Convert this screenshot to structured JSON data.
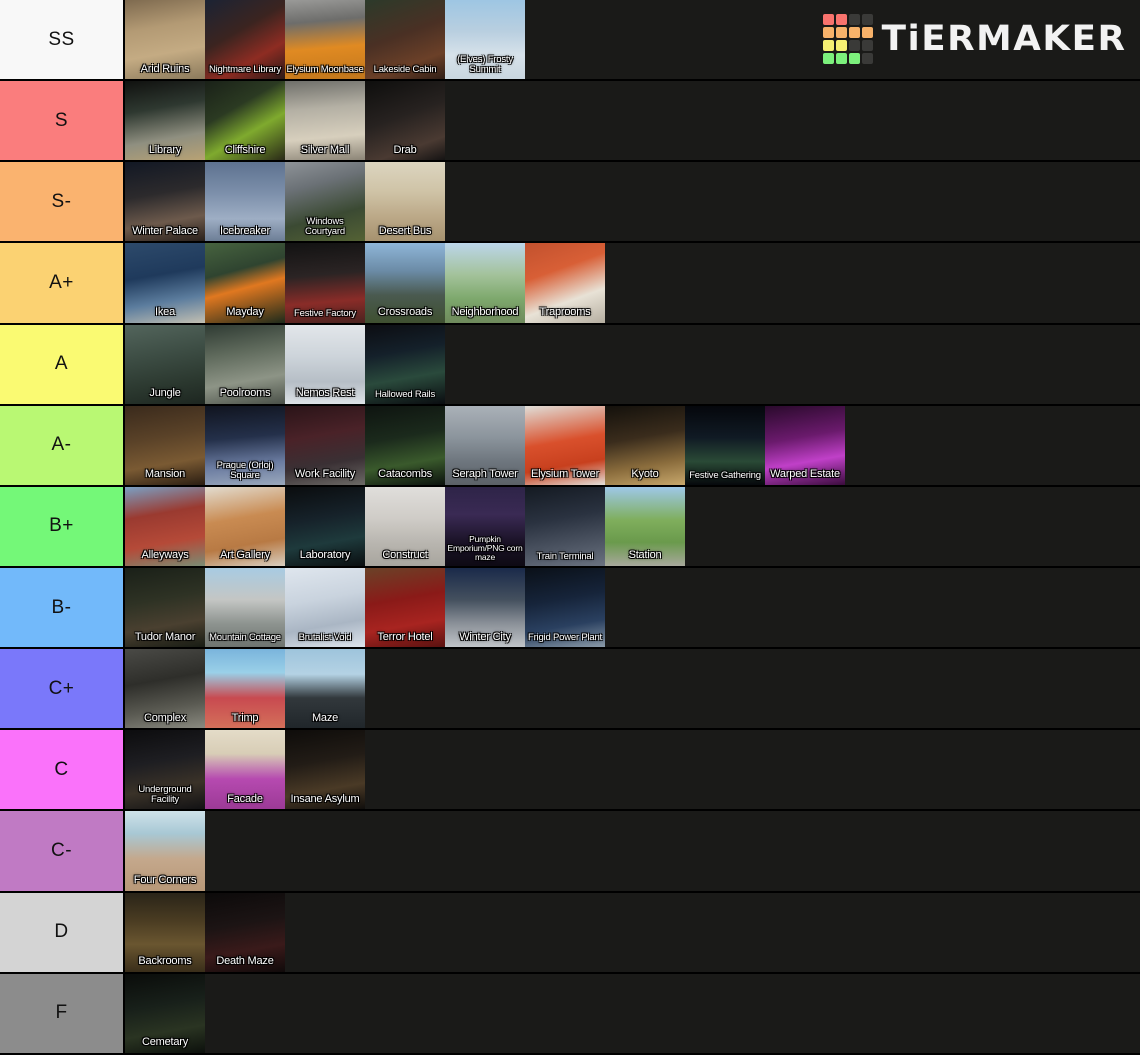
{
  "brand": {
    "name": "TiERMAKER",
    "logo_icon": "tiermaker-grid-logo",
    "text_color": "#f2f2f2",
    "grid_colors": [
      [
        "#f9736d",
        "#f9736d",
        "#3a3a38",
        "#3a3a38"
      ],
      [
        "#f7b26a",
        "#f7b26a",
        "#f7b26a",
        "#f7b26a"
      ],
      [
        "#f6f072",
        "#f6f072",
        "#3a3a38",
        "#3a3a38"
      ],
      [
        "#7cf07c",
        "#7cf07c",
        "#7cf07c",
        "#3a3a38"
      ]
    ]
  },
  "background_color": "#1a1a18",
  "tiers": [
    {
      "label": "SS",
      "color": "#f8f8f8",
      "items": [
        {
          "name": "Arid Ruins",
          "art": "linear-gradient(170deg,#7e6a4f 0%,#b39a74 35%,#c4ab83 65%,#8b7a5c 100%)"
        },
        {
          "name": "Nightmare Library",
          "art": "linear-gradient(150deg,#1b2334 0%,#3b2420 40%,#8e2c22 70%,#2a1a18 100%)"
        },
        {
          "name": "Elysium Moonbase",
          "art": "linear-gradient(175deg,#9a9a98 0%,#6d6d6b 28%,#e08a22 60%,#c2771c 100%)"
        },
        {
          "name": "Lakeside Cabin",
          "art": "linear-gradient(160deg,#2c3a2a 0%,#4a3024 45%,#6b4028 75%,#301e16 100%)"
        },
        {
          "name": "(Elves) Frosty Summit",
          "art": "linear-gradient(180deg,#9ec6e3 0%,#b9cfe0 40%,#d7e2ea 70%,#c9d6df 100%)"
        }
      ]
    },
    {
      "label": "S",
      "color": "#fa7d7d",
      "items": [
        {
          "name": "Library",
          "art": "linear-gradient(170deg,#10110f 0%,#2e3830 35%,#8f8f80 70%,#b8a274 100%)"
        },
        {
          "name": "Cliffshire",
          "art": "linear-gradient(150deg,#1a2118 0%,#2b3a22 35%,#7faa2e 62%,#2a2a18 100%)"
        },
        {
          "name": "Silver Mall",
          "art": "linear-gradient(175deg,#6f6f6a 0%,#b4b0a4 35%,#d7cfbd 70%,#8c8577 100%)"
        },
        {
          "name": "Drab",
          "art": "linear-gradient(160deg,#0e0e0d 0%,#272220 45%,#4a3a32 78%,#151313 100%)"
        }
      ]
    },
    {
      "label": "S-",
      "color": "#fab36f",
      "items": [
        {
          "name": "Winter Palace",
          "art": "linear-gradient(170deg,#121824 0%,#2c2a2c 40%,#6d5a4c 72%,#2a211c 100%)"
        },
        {
          "name": "Icebreaker",
          "art": "linear-gradient(180deg,#5e7290 0%,#7d90ab 40%,#9eaec4 72%,#6d7e96 100%)"
        },
        {
          "name": "Windows Courtyard",
          "art": "linear-gradient(165deg,#8e9398 0%,#6b7176 30%,#3b4a33 66%,#546234 100%)"
        },
        {
          "name": "Desert Bus",
          "art": "linear-gradient(180deg,#dcd5c0 0%,#cfc3a6 38%,#bba887 70%,#a6926f 100%)"
        }
      ]
    },
    {
      "label": "A+",
      "color": "#fbd272",
      "items": [
        {
          "name": "Ikea",
          "art": "linear-gradient(170deg,#2d4a6b 0%,#1f3a5c 40%,#5c7d9e 70%,#c3c0b2 100%)"
        },
        {
          "name": "Mayday",
          "art": "linear-gradient(165deg,#47633f 0%,#2f4430 35%,#e07820 55%,#1d2a1b 100%)"
        },
        {
          "name": "Festive Factory",
          "art": "linear-gradient(175deg,#121212 0%,#2b2424 40%,#8a2c28 72%,#4a2320 100%)"
        },
        {
          "name": "Crossroads",
          "art": "linear-gradient(180deg,#8fb6d8 0%,#6b8ba6 35%,#4a5a50 65%,#3f5030 100%)"
        },
        {
          "name": "Neighborhood",
          "art": "linear-gradient(180deg,#bcd6ea 0%,#a3c29a 40%,#7da86c 70%,#6f8a5c 100%)"
        },
        {
          "name": "Traprooms",
          "art": "linear-gradient(160deg,#c2512e 0%,#d85f36 35%,#e8e2d6 68%,#b5aea0 100%)"
        }
      ]
    },
    {
      "label": "A",
      "color": "#fafa72",
      "items": [
        {
          "name": "Jungle",
          "art": "linear-gradient(170deg,#53655c 0%,#3c4c43 40%,#2b382f 72%,#1d2620 100%)"
        },
        {
          "name": "Poolrooms",
          "art": "linear-gradient(170deg,#2f3b33 0%,#5f6a5c 35%,#8d9486 68%,#4a5048 100%)"
        },
        {
          "name": "Nemos Rest",
          "art": "linear-gradient(180deg,#e2e6ea 0%,#cdd4da 40%,#b6bec6 72%,#dde2e6 100%)"
        },
        {
          "name": "Hallowed Rails",
          "art": "linear-gradient(170deg,#0c0d12 0%,#14202a 35%,#2a4a3c 65%,#0a0c10 100%)"
        }
      ]
    },
    {
      "label": "A-",
      "color": "#b9f873",
      "items": [
        {
          "name": "Mansion",
          "art": "linear-gradient(170deg,#3a2a1c 0%,#5a4228 40%,#7a5a33 70%,#2a1d12 100%)"
        },
        {
          "name": "Prague (Orloj) Square",
          "art": "linear-gradient(175deg,#10141f 0%,#24304a 40%,#6a7ba0 72%,#9aa8bc 100%)"
        },
        {
          "name": "Work Facility",
          "art": "linear-gradient(170deg,#2a1418 0%,#4a2228 38%,#3a3034 70%,#6c6a66 100%)"
        },
        {
          "name": "Catacombs",
          "art": "linear-gradient(170deg,#0e1410 0%,#1b2a1c 40%,#3a5a2c 70%,#0c120e 100%)"
        },
        {
          "name": "Seraph Tower",
          "art": "linear-gradient(180deg,#aab1b8 0%,#8b949c 40%,#6e767e 70%,#5c6268 100%)"
        },
        {
          "name": "Elysium Tower",
          "art": "linear-gradient(170deg,#e0ded8 0%,#d9502c 45%,#c8401e 72%,#e2e0da 100%)"
        },
        {
          "name": "Kyoto",
          "art": "linear-gradient(170deg,#14110c 0%,#3a2c1c 40%,#8a6c3c 72%,#c8a86c 100%)"
        },
        {
          "name": "Festive Gathering",
          "art": "linear-gradient(180deg,#05070c 0%,#101a24 40%,#2a4a36 70%,#06080c 100%)"
        },
        {
          "name": "Warped Estate",
          "art": "linear-gradient(170deg,#2a0a2c 0%,#6a1a6c 40%,#c040c8 68%,#3a0c3c 100%)"
        }
      ]
    },
    {
      "label": "B+",
      "color": "#74f878",
      "items": [
        {
          "name": "Alleyways",
          "art": "linear-gradient(170deg,#7aa0c4 0%,#9a3a30 35%,#b54a38 68%,#7a8c74 100%)"
        },
        {
          "name": "Art Gallery",
          "art": "linear-gradient(170deg,#e2dcd0 0%,#c98b52 40%,#b87a44 70%,#d8cfc0 100%)"
        },
        {
          "name": "Laboratory",
          "art": "linear-gradient(170deg,#0a0c0e 0%,#16222a 40%,#1e3a3c 68%,#0a0e10 100%)"
        },
        {
          "name": "Construct",
          "art": "linear-gradient(180deg,#e0dedb 0%,#cfccc7 40%,#b9b6b0 70%,#a8a59e 100%)"
        },
        {
          "name": "Pumpkin Emporium/PNG corn maze",
          "art": "linear-gradient(180deg,#2e2448 0%,#3a2a54 35%,#1a1226 70%,#0e0a14 100%)"
        },
        {
          "name": "Train Terminal",
          "art": "linear-gradient(170deg,#141a22 0%,#2a3240 40%,#4a5260 70%,#6a7280 100%)"
        },
        {
          "name": "Station",
          "art": "linear-gradient(180deg,#9ec8e8 0%,#7fae5c 42%,#6a9a4c 70%,#a8a89c 100%)"
        }
      ]
    },
    {
      "label": "B-",
      "color": "#72b9fa",
      "items": [
        {
          "name": "Tudor Manor",
          "art": "linear-gradient(170deg,#1a2018 0%,#2e3224 40%,#4a4030 70%,#181c14 100%)"
        },
        {
          "name": "Mountain Cottage",
          "art": "linear-gradient(180deg,#a8cbe2 0%,#c4c6c4 40%,#8e9490 70%,#6e7470 100%)"
        },
        {
          "name": "Brutalist Void",
          "art": "linear-gradient(170deg,#dfe6ee 0%,#c9d3de 40%,#aab6c4 70%,#dde4ec 100%)"
        },
        {
          "name": "Terror Hotel",
          "art": "linear-gradient(170deg,#6a4228 0%,#8a1a18 40%,#a82420 70%,#5a1210 100%)"
        },
        {
          "name": "Winter City",
          "art": "linear-gradient(180deg,#1a2a4a 0%,#44505e 40%,#8a9098 70%,#c0c4c8 100%)"
        },
        {
          "name": "Frigid Power Plant",
          "art": "linear-gradient(170deg,#0a1018 0%,#16243a 40%,#2a4060 70%,#8a9aa8 100%)"
        }
      ]
    },
    {
      "label": "C+",
      "color": "#7a78fa",
      "items": [
        {
          "name": "Complex",
          "art": "linear-gradient(170deg,#4a4a46 0%,#2e2e2a 40%,#5a5a52 72%,#8a8a80 100%)"
        },
        {
          "name": "Trimp",
          "art": "linear-gradient(180deg,#7ab4dc 0%,#9ad0e8 30%,#c84a50 62%,#d4705a 100%)"
        },
        {
          "name": "Maze",
          "art": "linear-gradient(180deg,#9ec4dc 0%,#b4d2e4 32%,#32383c 62%,#20262a 100%)"
        }
      ]
    },
    {
      "label": "C",
      "color": "#fa72fa",
      "items": [
        {
          "name": "Underground Facility",
          "art": "linear-gradient(170deg,#0c0c0e 0%,#1e1e22 40%,#3a3228 70%,#121214 100%)"
        },
        {
          "name": "Facade",
          "art": "linear-gradient(180deg,#e4dcc8 0%,#d8cdb6 30%,#b64ab0 62%,#9c3a96 100%)"
        },
        {
          "name": "Insane Asylum",
          "art": "linear-gradient(170deg,#0e0c0a 0%,#221c16 40%,#4a3a26 72%,#100e0c 100%)"
        }
      ]
    },
    {
      "label": "C-",
      "color": "#c07ac4",
      "items": [
        {
          "name": "Four Corners",
          "art": "linear-gradient(180deg,#cfe2ea 0%,#a8c8d4 28%,#c4a88c 60%,#b89878 100%)"
        }
      ]
    },
    {
      "label": "D",
      "color": "#d4d4d4",
      "items": [
        {
          "name": "Backrooms",
          "art": "linear-gradient(180deg,#2a2418 0%,#4a3c22 35%,#6a5630 65%,#3a2e1a 100%)"
        },
        {
          "name": "Death Maze",
          "art": "linear-gradient(170deg,#0c0a0a 0%,#1c1414 40%,#3a1a1a 70%,#100a0a 100%)"
        }
      ]
    },
    {
      "label": "F",
      "color": "#8c8c8c",
      "items": [
        {
          "name": "Cemetary",
          "art": "linear-gradient(170deg,#0a0c0a 0%,#18201a 40%,#2a3422 70%,#0c100c 100%)"
        }
      ]
    }
  ]
}
